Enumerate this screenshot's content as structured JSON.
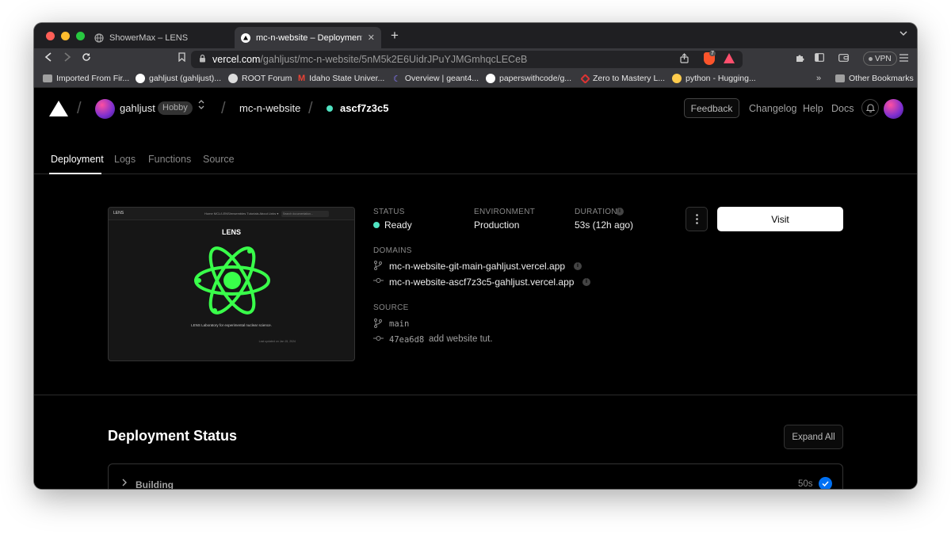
{
  "browser": {
    "tabs": [
      {
        "title": "ShowerMax – LENS",
        "favicon": "globe-icon",
        "active": false
      },
      {
        "title": "mc-n-website – Deployment Ov",
        "favicon": "vercel-icon",
        "active": true
      }
    ],
    "url": {
      "host": "vercel.com",
      "path": "/gahljust/mc-n-website/5nM5k2E6UidrJPuYJMGmhqcLECeB"
    },
    "brave_badge": "7",
    "vpn_label": "VPN",
    "bookmarks": [
      {
        "label": "Imported From Fir...",
        "icon": "folder-icon"
      },
      {
        "label": "gahljust (gahljust)...",
        "icon": "github-icon"
      },
      {
        "label": "ROOT Forum",
        "icon": "root-icon"
      },
      {
        "label": "Idaho State Univer...",
        "icon": "gmail-icon"
      },
      {
        "label": "Overview | geant4...",
        "icon": "geant-icon"
      },
      {
        "label": "paperswithcode/g...",
        "icon": "github-icon"
      },
      {
        "label": "Zero to Mastery L...",
        "icon": "ztm-icon"
      },
      {
        "label": "python - Hugging...",
        "icon": "huggingface-icon"
      }
    ],
    "bookmarks_more": "»",
    "other_bookmarks": "Other Bookmarks"
  },
  "vercel": {
    "team": "gahljust",
    "plan_badge": "Hobby",
    "project": "mc-n-website",
    "deployment_id": "ascf7z3c5",
    "feedback_label": "Feedback",
    "top_links": [
      "Changelog",
      "Help",
      "Docs"
    ],
    "subtabs": [
      "Deployment",
      "Logs",
      "Functions",
      "Source"
    ],
    "active_subtab": "Deployment",
    "preview": {
      "logo": "LENS",
      "nav_links": "Home   MCL/LENS/ensembles   Tutorials   About   Links  ▾",
      "search_placeholder": "Search documentation...",
      "title": "LENS",
      "tagline": "LENS Laboratory for experimental nuclear science.",
      "footer": "Last updated on Jan 15, 2024"
    },
    "status": {
      "label": "Status",
      "value": "Ready",
      "color": "#50e3c2"
    },
    "environment": {
      "label": "Environment",
      "value": "Production"
    },
    "duration": {
      "label": "Duration",
      "value": "53s (12h ago)"
    },
    "visit_label": "Visit",
    "domains_label": "Domains",
    "domains": [
      {
        "url": "mc-n-website-git-main-gahljust.vercel.app",
        "icon": "branch-icon"
      },
      {
        "url": "mc-n-website-ascf7z3c5-gahljust.vercel.app",
        "icon": "commit-icon"
      }
    ],
    "source_label": "Source",
    "source": {
      "branch": "main",
      "commit_hash": "47ea6d8",
      "commit_message": "add website tut."
    },
    "deployment_status_title": "Deployment Status",
    "expand_all_label": "Expand All",
    "build_step": {
      "label": "Building",
      "duration": "50s"
    }
  }
}
